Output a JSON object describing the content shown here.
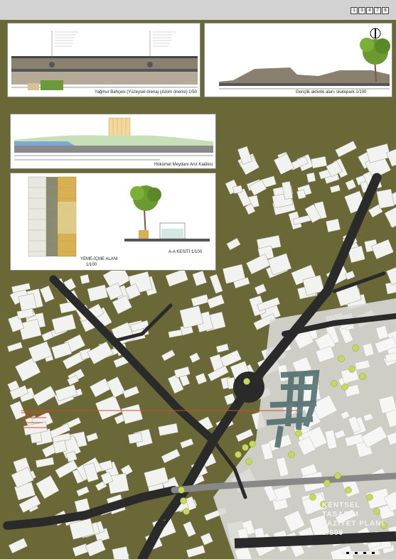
{
  "sheet_number": [
    "1",
    "3",
    "4",
    "7",
    "6"
  ],
  "panels": {
    "rain_garden": {
      "caption": "Yağmur Bahçesi (Yüzeysel drenaj çözüm önerisi) 1/50"
    },
    "skatepark": {
      "caption": "Gençlik aktivite alanı skatepark 1/100"
    },
    "monument": {
      "caption": "Hükümet Meydanı Anıt Kaidesi"
    },
    "eating_area": {
      "plan_caption": "YEME-İÇME ALANI",
      "plan_scale": "1/100",
      "section_caption": "A-A KESİTİ 1/100"
    }
  },
  "plan_title": {
    "line1": "KENTSEL TASARIM",
    "line2": "VAZİYET PLANI",
    "line3": "1/500"
  },
  "colors": {
    "background": "#6b6838",
    "roads": "#2a2a2a",
    "blocks": "#f2f2f0",
    "accent_red": "#d24a2a",
    "teal_grid": "#4a6a6a",
    "trees": "#c8d85a"
  }
}
